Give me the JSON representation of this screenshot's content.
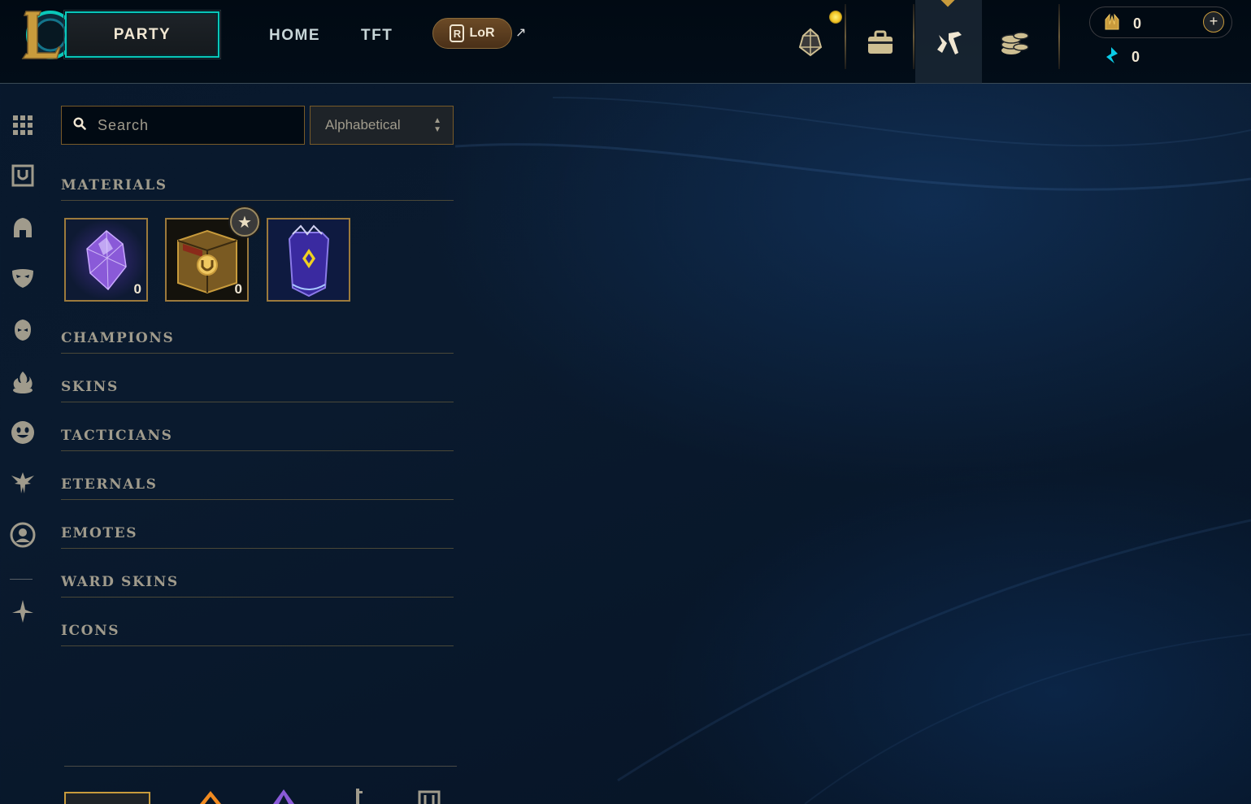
{
  "topbar": {
    "party_label": "PARTY",
    "nav": [
      {
        "label": "HOME"
      },
      {
        "label": "TFT"
      }
    ],
    "lor_label": "LoR",
    "lor_badge": "R",
    "external_arrow": "↗",
    "icons": [
      "crystal-icon",
      "backpack-icon",
      "loot-crafting-icon",
      "coins-icon"
    ]
  },
  "currency": {
    "rp": "0",
    "blue_essence": "0",
    "add_symbol": "+"
  },
  "rail": {
    "icons": [
      "grid-icon",
      "collection-icon",
      "helmet-icon",
      "mask-icon",
      "champion-face-icon",
      "flame-icon",
      "emote-face-icon",
      "eternals-icon",
      "profile-icon",
      "ward-icon"
    ]
  },
  "search": {
    "placeholder": "Search",
    "value": ""
  },
  "sort": {
    "selected": "Alphabetical",
    "arrows": "▲▼"
  },
  "categories": [
    {
      "label": "MATERIALS"
    },
    {
      "label": "CHAMPIONS"
    },
    {
      "label": "SKINS"
    },
    {
      "label": "TACTICIANS"
    },
    {
      "label": "ETERNALS"
    },
    {
      "label": "EMOTES"
    },
    {
      "label": "WARD SKINS"
    },
    {
      "label": "ICONS"
    }
  ],
  "materials": [
    {
      "name": "orange-essence-crystal",
      "count": "0"
    },
    {
      "name": "hextech-chest",
      "count": "0"
    },
    {
      "name": "mythic-key-item",
      "count": ""
    }
  ],
  "colors": {
    "gold": "#c89b3c",
    "teal": "#0ac8b9",
    "text": "#a09b8c"
  }
}
